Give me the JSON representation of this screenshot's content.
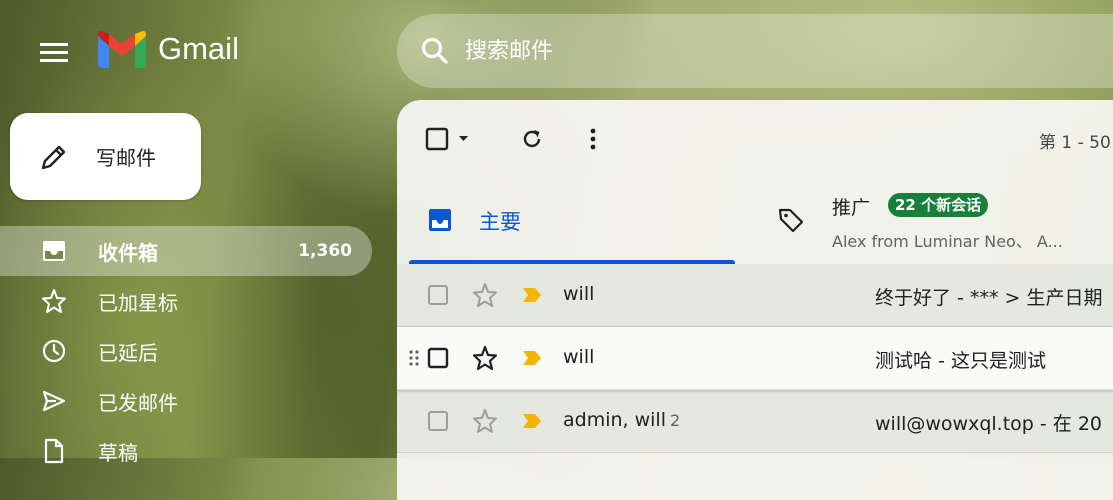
{
  "app": {
    "name": "Gmail"
  },
  "search": {
    "placeholder": "搜索邮件"
  },
  "compose": {
    "label": "写邮件"
  },
  "nav": {
    "items": [
      {
        "label": "收件箱",
        "count": "1,360",
        "icon": "inbox-icon"
      },
      {
        "label": "已加星标",
        "icon": "star-icon"
      },
      {
        "label": "已延后",
        "icon": "clock-icon"
      },
      {
        "label": "已发邮件",
        "icon": "send-icon"
      },
      {
        "label": "草稿",
        "icon": "draft-icon"
      }
    ]
  },
  "toolbar": {
    "pager": "第 1 - 50"
  },
  "tabs": {
    "primary": {
      "label": "主要"
    },
    "promotions": {
      "label": "推广",
      "badge": "22 个新会话",
      "snippet": "Alex from Luminar Neo、 A..."
    }
  },
  "emails": [
    {
      "sender": "will",
      "thread_count": "",
      "subject": "终于好了",
      "snippet": " - *** > 生产日期",
      "starred": false,
      "important": true
    },
    {
      "sender": "will",
      "thread_count": "",
      "subject": "测试哈",
      "snippet": " - 这只是测试",
      "starred": false,
      "important": true
    },
    {
      "sender": "admin, will",
      "thread_count": "2",
      "subject": "will@wowxql.top",
      "snippet": " - 在 20",
      "starred": false,
      "important": true
    }
  ],
  "colors": {
    "accent": "#0b57d0",
    "badge": "#188038",
    "important_marker": "#f4b400"
  }
}
